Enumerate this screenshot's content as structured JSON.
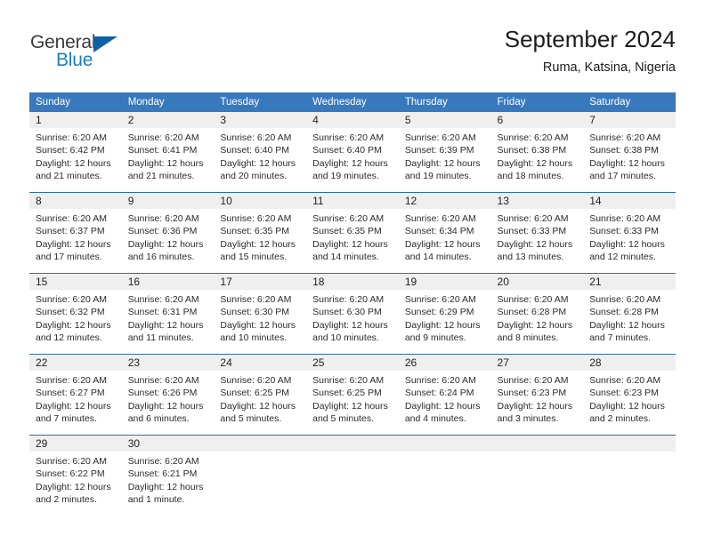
{
  "brand": {
    "name_part1": "General",
    "name_part2": "Blue",
    "triangle_icon": "triangle-icon",
    "color_dark": "#3b3b3b",
    "color_blue": "#1a7fc1"
  },
  "header": {
    "title": "September 2024",
    "subtitle": "Ruma, Katsina, Nigeria"
  },
  "theme": {
    "header_bg": "#3878bd",
    "header_text": "#ffffff",
    "row_divider": "#2e6da8",
    "daynum_band": "#efefef"
  },
  "weekday_headers": [
    "Sunday",
    "Monday",
    "Tuesday",
    "Wednesday",
    "Thursday",
    "Friday",
    "Saturday"
  ],
  "labels": {
    "sunrise_prefix": "Sunrise:",
    "sunset_prefix": "Sunset:",
    "daylight_prefix": "Daylight:"
  },
  "weeks": [
    [
      {
        "day": "1",
        "sunrise": "Sunrise: 6:20 AM",
        "sunset": "Sunset: 6:42 PM",
        "daylight_line1": "Daylight: 12 hours",
        "daylight_line2": "and 21 minutes."
      },
      {
        "day": "2",
        "sunrise": "Sunrise: 6:20 AM",
        "sunset": "Sunset: 6:41 PM",
        "daylight_line1": "Daylight: 12 hours",
        "daylight_line2": "and 21 minutes."
      },
      {
        "day": "3",
        "sunrise": "Sunrise: 6:20 AM",
        "sunset": "Sunset: 6:40 PM",
        "daylight_line1": "Daylight: 12 hours",
        "daylight_line2": "and 20 minutes."
      },
      {
        "day": "4",
        "sunrise": "Sunrise: 6:20 AM",
        "sunset": "Sunset: 6:40 PM",
        "daylight_line1": "Daylight: 12 hours",
        "daylight_line2": "and 19 minutes."
      },
      {
        "day": "5",
        "sunrise": "Sunrise: 6:20 AM",
        "sunset": "Sunset: 6:39 PM",
        "daylight_line1": "Daylight: 12 hours",
        "daylight_line2": "and 19 minutes."
      },
      {
        "day": "6",
        "sunrise": "Sunrise: 6:20 AM",
        "sunset": "Sunset: 6:38 PM",
        "daylight_line1": "Daylight: 12 hours",
        "daylight_line2": "and 18 minutes."
      },
      {
        "day": "7",
        "sunrise": "Sunrise: 6:20 AM",
        "sunset": "Sunset: 6:38 PM",
        "daylight_line1": "Daylight: 12 hours",
        "daylight_line2": "and 17 minutes."
      }
    ],
    [
      {
        "day": "8",
        "sunrise": "Sunrise: 6:20 AM",
        "sunset": "Sunset: 6:37 PM",
        "daylight_line1": "Daylight: 12 hours",
        "daylight_line2": "and 17 minutes."
      },
      {
        "day": "9",
        "sunrise": "Sunrise: 6:20 AM",
        "sunset": "Sunset: 6:36 PM",
        "daylight_line1": "Daylight: 12 hours",
        "daylight_line2": "and 16 minutes."
      },
      {
        "day": "10",
        "sunrise": "Sunrise: 6:20 AM",
        "sunset": "Sunset: 6:35 PM",
        "daylight_line1": "Daylight: 12 hours",
        "daylight_line2": "and 15 minutes."
      },
      {
        "day": "11",
        "sunrise": "Sunrise: 6:20 AM",
        "sunset": "Sunset: 6:35 PM",
        "daylight_line1": "Daylight: 12 hours",
        "daylight_line2": "and 14 minutes."
      },
      {
        "day": "12",
        "sunrise": "Sunrise: 6:20 AM",
        "sunset": "Sunset: 6:34 PM",
        "daylight_line1": "Daylight: 12 hours",
        "daylight_line2": "and 14 minutes."
      },
      {
        "day": "13",
        "sunrise": "Sunrise: 6:20 AM",
        "sunset": "Sunset: 6:33 PM",
        "daylight_line1": "Daylight: 12 hours",
        "daylight_line2": "and 13 minutes."
      },
      {
        "day": "14",
        "sunrise": "Sunrise: 6:20 AM",
        "sunset": "Sunset: 6:33 PM",
        "daylight_line1": "Daylight: 12 hours",
        "daylight_line2": "and 12 minutes."
      }
    ],
    [
      {
        "day": "15",
        "sunrise": "Sunrise: 6:20 AM",
        "sunset": "Sunset: 6:32 PM",
        "daylight_line1": "Daylight: 12 hours",
        "daylight_line2": "and 12 minutes."
      },
      {
        "day": "16",
        "sunrise": "Sunrise: 6:20 AM",
        "sunset": "Sunset: 6:31 PM",
        "daylight_line1": "Daylight: 12 hours",
        "daylight_line2": "and 11 minutes."
      },
      {
        "day": "17",
        "sunrise": "Sunrise: 6:20 AM",
        "sunset": "Sunset: 6:30 PM",
        "daylight_line1": "Daylight: 12 hours",
        "daylight_line2": "and 10 minutes."
      },
      {
        "day": "18",
        "sunrise": "Sunrise: 6:20 AM",
        "sunset": "Sunset: 6:30 PM",
        "daylight_line1": "Daylight: 12 hours",
        "daylight_line2": "and 10 minutes."
      },
      {
        "day": "19",
        "sunrise": "Sunrise: 6:20 AM",
        "sunset": "Sunset: 6:29 PM",
        "daylight_line1": "Daylight: 12 hours",
        "daylight_line2": "and 9 minutes."
      },
      {
        "day": "20",
        "sunrise": "Sunrise: 6:20 AM",
        "sunset": "Sunset: 6:28 PM",
        "daylight_line1": "Daylight: 12 hours",
        "daylight_line2": "and 8 minutes."
      },
      {
        "day": "21",
        "sunrise": "Sunrise: 6:20 AM",
        "sunset": "Sunset: 6:28 PM",
        "daylight_line1": "Daylight: 12 hours",
        "daylight_line2": "and 7 minutes."
      }
    ],
    [
      {
        "day": "22",
        "sunrise": "Sunrise: 6:20 AM",
        "sunset": "Sunset: 6:27 PM",
        "daylight_line1": "Daylight: 12 hours",
        "daylight_line2": "and 7 minutes."
      },
      {
        "day": "23",
        "sunrise": "Sunrise: 6:20 AM",
        "sunset": "Sunset: 6:26 PM",
        "daylight_line1": "Daylight: 12 hours",
        "daylight_line2": "and 6 minutes."
      },
      {
        "day": "24",
        "sunrise": "Sunrise: 6:20 AM",
        "sunset": "Sunset: 6:25 PM",
        "daylight_line1": "Daylight: 12 hours",
        "daylight_line2": "and 5 minutes."
      },
      {
        "day": "25",
        "sunrise": "Sunrise: 6:20 AM",
        "sunset": "Sunset: 6:25 PM",
        "daylight_line1": "Daylight: 12 hours",
        "daylight_line2": "and 5 minutes."
      },
      {
        "day": "26",
        "sunrise": "Sunrise: 6:20 AM",
        "sunset": "Sunset: 6:24 PM",
        "daylight_line1": "Daylight: 12 hours",
        "daylight_line2": "and 4 minutes."
      },
      {
        "day": "27",
        "sunrise": "Sunrise: 6:20 AM",
        "sunset": "Sunset: 6:23 PM",
        "daylight_line1": "Daylight: 12 hours",
        "daylight_line2": "and 3 minutes."
      },
      {
        "day": "28",
        "sunrise": "Sunrise: 6:20 AM",
        "sunset": "Sunset: 6:23 PM",
        "daylight_line1": "Daylight: 12 hours",
        "daylight_line2": "and 2 minutes."
      }
    ],
    [
      {
        "day": "29",
        "sunrise": "Sunrise: 6:20 AM",
        "sunset": "Sunset: 6:22 PM",
        "daylight_line1": "Daylight: 12 hours",
        "daylight_line2": "and 2 minutes."
      },
      {
        "day": "30",
        "sunrise": "Sunrise: 6:20 AM",
        "sunset": "Sunset: 6:21 PM",
        "daylight_line1": "Daylight: 12 hours",
        "daylight_line2": "and 1 minute."
      },
      {
        "day": "",
        "sunrise": "",
        "sunset": "",
        "daylight_line1": "",
        "daylight_line2": ""
      },
      {
        "day": "",
        "sunrise": "",
        "sunset": "",
        "daylight_line1": "",
        "daylight_line2": ""
      },
      {
        "day": "",
        "sunrise": "",
        "sunset": "",
        "daylight_line1": "",
        "daylight_line2": ""
      },
      {
        "day": "",
        "sunrise": "",
        "sunset": "",
        "daylight_line1": "",
        "daylight_line2": ""
      },
      {
        "day": "",
        "sunrise": "",
        "sunset": "",
        "daylight_line1": "",
        "daylight_line2": ""
      }
    ]
  ]
}
